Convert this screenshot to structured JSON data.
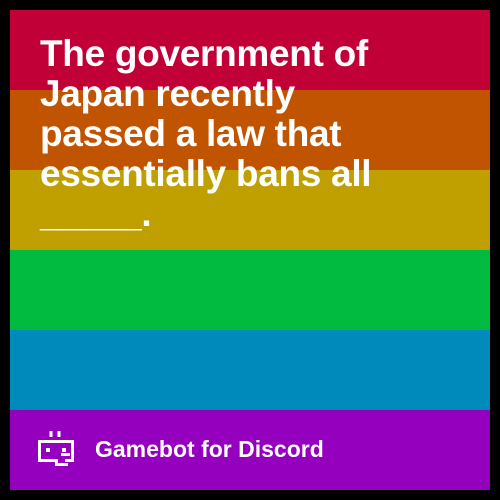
{
  "card": {
    "prompt_text": "The government of\nJapan recently\npassed a law that\nessentially bans all\n_____.",
    "stripe_colors": [
      "#c00037",
      "#c05400",
      "#bfa000",
      "#00bb3f",
      "#008abb",
      "#9400bd"
    ]
  },
  "branding": {
    "icon": "gamebot-robot-icon",
    "name": "Gamebot for Discord"
  }
}
